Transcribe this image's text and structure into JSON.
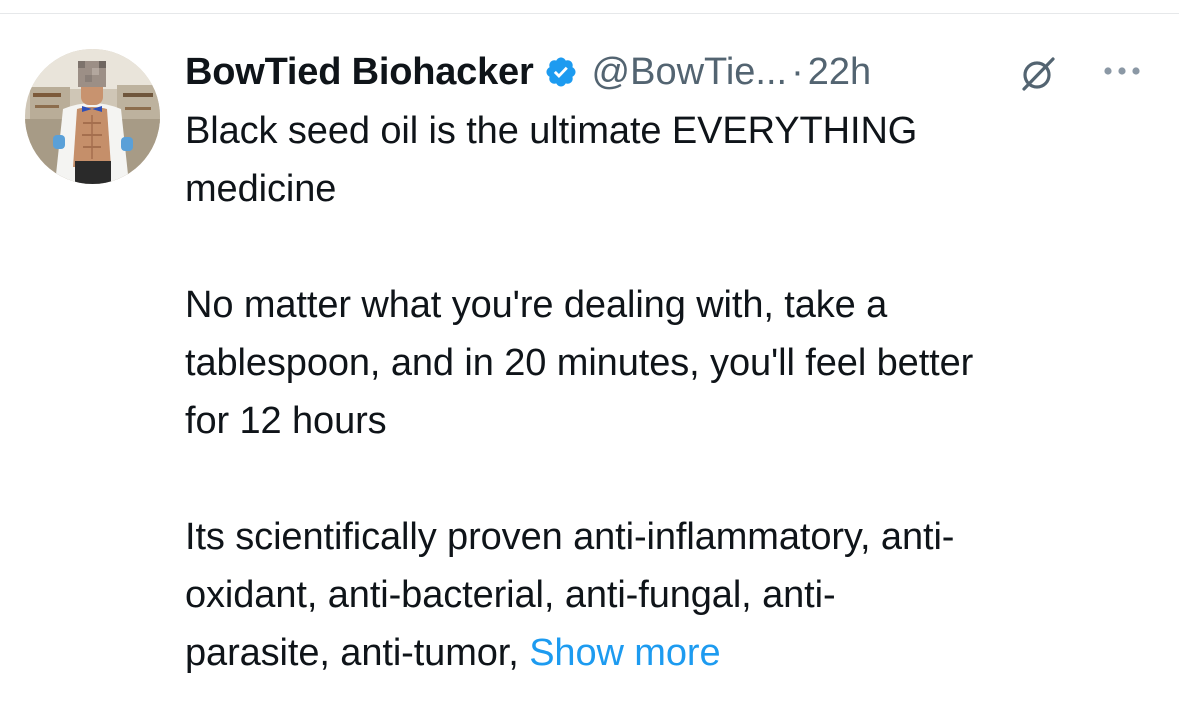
{
  "tweet": {
    "author": {
      "display_name": "BowTied Biohacker",
      "handle": "@BowTie...",
      "verified": true,
      "avatar_icon": "profile-photo"
    },
    "separator": "·",
    "timestamp": "22h",
    "actions": {
      "grok_icon": "grok-slash-circle-icon",
      "more_icon": "more-dots-icon"
    },
    "text": {
      "paragraph_1_lines": [
        "Black seed oil is the ultimate EVERYTHING",
        "medicine"
      ],
      "paragraph_2_lines": [
        "No matter what you're dealing with, take a",
        "tablespoon, and in 20 minutes, you'll feel better",
        "for 12 hours"
      ],
      "paragraph_3_lines": [
        "Its scientifically proven anti-inflammatory, anti-",
        "oxidant, anti-bacterial, anti-fungal, anti-",
        "parasite, anti-tumor, "
      ],
      "show_more": "Show more"
    },
    "colors": {
      "text": "#0f1419",
      "secondary": "#536471",
      "link": "#1d9bf0",
      "verified": "#1d9bf0"
    }
  }
}
